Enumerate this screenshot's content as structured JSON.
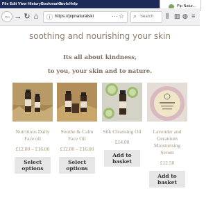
{
  "menubar": {
    "items": [
      "File",
      "Edit",
      "View",
      "History",
      "Bookmarks",
      "Tools",
      "Help"
    ],
    "tab_title": "Pip Natur..."
  },
  "toolbar": {
    "url": "https://pipnaturalski",
    "search_placeholder": "Search",
    "more_glyph": "⋯",
    "star_glyph": "☆"
  },
  "page": {
    "heading": "soothing and nourishing your skin",
    "tagline_1": "Its all about kindness,",
    "tagline_2": "to you, your skin and to nature."
  },
  "products": [
    {
      "name": "Nutritious Daily Face oil",
      "price": "£12.00 – £16.00",
      "button": "Select options"
    },
    {
      "name": "Soothe & Calm Face Oil",
      "price": "£12.00 – £16.00",
      "button": "Select options"
    },
    {
      "name": "Silk Cleansing Oil",
      "price": "£14.00",
      "button": "Add to basket"
    },
    {
      "name": "Lavender and Geranium Moisturising Serum",
      "price": "£12.50",
      "button": "Add to basket"
    }
  ],
  "colors": {
    "menubar_bg": "#1b2a57",
    "text_brown": "#8a7d6d",
    "button_bg": "#e6e6e6"
  }
}
